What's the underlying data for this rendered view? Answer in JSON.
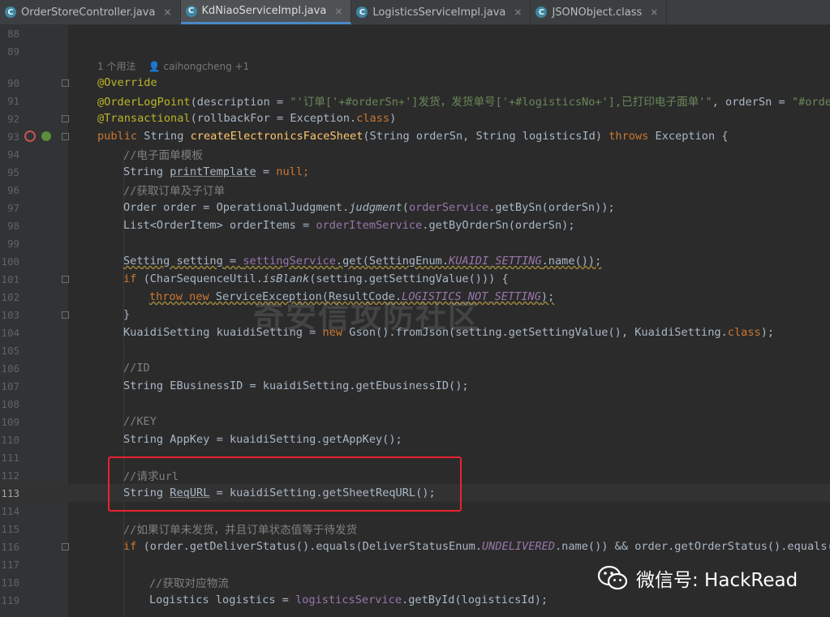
{
  "tabs": [
    {
      "label": "OrderStoreController.java",
      "active": false
    },
    {
      "label": "KdNiaoServiceImpl.java",
      "active": true
    },
    {
      "label": "LogisticsServiceImpl.java",
      "active": false
    },
    {
      "label": "JSONObject.class",
      "active": false
    }
  ],
  "tab_close_glyph": "×",
  "class_icon_letter": "C",
  "line_numbers": [
    "88",
    "89",
    "90",
    "91",
    "92",
    "93",
    "94",
    "95",
    "96",
    "97",
    "98",
    "99",
    "100",
    "101",
    "102",
    "103",
    "104",
    "105",
    "106",
    "107",
    "108",
    "109",
    "110",
    "111",
    "112",
    "113",
    "114",
    "115",
    "116",
    "117",
    "118",
    "119"
  ],
  "usage_hint": {
    "usages": "1 个用法",
    "author": "caihongcheng +1"
  },
  "code": {
    "l90": "@Override",
    "l91": {
      "a": "@OrderLogPoint",
      "b": "(description = ",
      "s": "\"'订单['+#orderSn+']发货，发货单号['+#logisticsNo+'],已打印电子面单'\"",
      "c": ", orderSn = ",
      "s2": "\"#orderSn"
    },
    "l92": {
      "a": "@Transactional",
      "b": "(rollbackFor = Exception.",
      "k": "class",
      "c": ")"
    },
    "l93": {
      "k1": "public ",
      "t1": "String ",
      "fn": "createElectronicsFaceSheet",
      "p": "(String orderSn, String logisticsId) ",
      "k2": "throws ",
      "t2": "Exception {"
    },
    "l94": "//电子面单模板",
    "l95": {
      "t": "String ",
      "v": "printTemplate",
      "e": " = ",
      "k": "null",
      "s": ";"
    },
    "l96": "//获取订单及子订单",
    "l97": {
      "a": "Order order = OperationalJudgment.",
      "i": "judgment",
      "b": "(",
      "f": "orderService",
      "c": ".getBySn(orderSn));"
    },
    "l98": {
      "a": "List<OrderItem> orderItems = ",
      "f": "orderItemService",
      "c": ".getByOrderSn(orderSn);"
    },
    "l100": {
      "a": "Setting setting",
      "e": " = ",
      "f": "settingService",
      "b": ".get(SettingEnum.",
      "fi": "KUAIDI_SETTING",
      "c": ".name());"
    },
    "l101": {
      "k": "if ",
      "a": "(CharSequenceUtil.",
      "i": "isBlank",
      "c": "(setting.getSettingValue())) {"
    },
    "l102": {
      "k1": "throw ",
      "k2": "new ",
      "a": "ServiceException(ResultCode.",
      "fi": "LOGISTICS_NOT_SETTING",
      "c": ");"
    },
    "l103": "}",
    "l104": {
      "a": "KuaidiSetting kuaidiSetting = ",
      "k": "new ",
      "b": "Gson().fromJson(setting.getSettingValue(), KuaidiSetting.",
      "k2": "class",
      "c": ");"
    },
    "l106": "//ID",
    "l107": "String EBusinessID = kuaidiSetting.getEbusinessID();",
    "l109": "//KEY",
    "l110": "String AppKey = kuaidiSetting.getAppKey();",
    "l112": "//请求url",
    "l113": {
      "a": "String ",
      "v": "ReqURL",
      "c": " = kuaidiSetting.getSheetReqURL();"
    },
    "l115": "//如果订单未发货，并且订单状态值等于待发货",
    "l116": {
      "k": "if ",
      "a": "(order.getDeliverStatus().equals(DeliverStatusEnum.",
      "fi": "UNDELIVERED",
      "c": ".name()) && order.getOrderStatus().equals(Or"
    },
    "l118": "//获取对应物流",
    "l119": {
      "a": "Logistics logistics = ",
      "f": "logisticsService",
      "c": ".getById(logisticsId);"
    }
  },
  "watermark": "奇安信攻防社区",
  "wechat_label": "微信号: HackRead",
  "colors": {
    "background": "#2b2b2b",
    "keyword": "#cc7832",
    "string": "#6a8759",
    "annotation": "#bbb529",
    "comment": "#808080",
    "highlight_box": "#e8232e",
    "active_tab_underline": "#4a88c7"
  }
}
